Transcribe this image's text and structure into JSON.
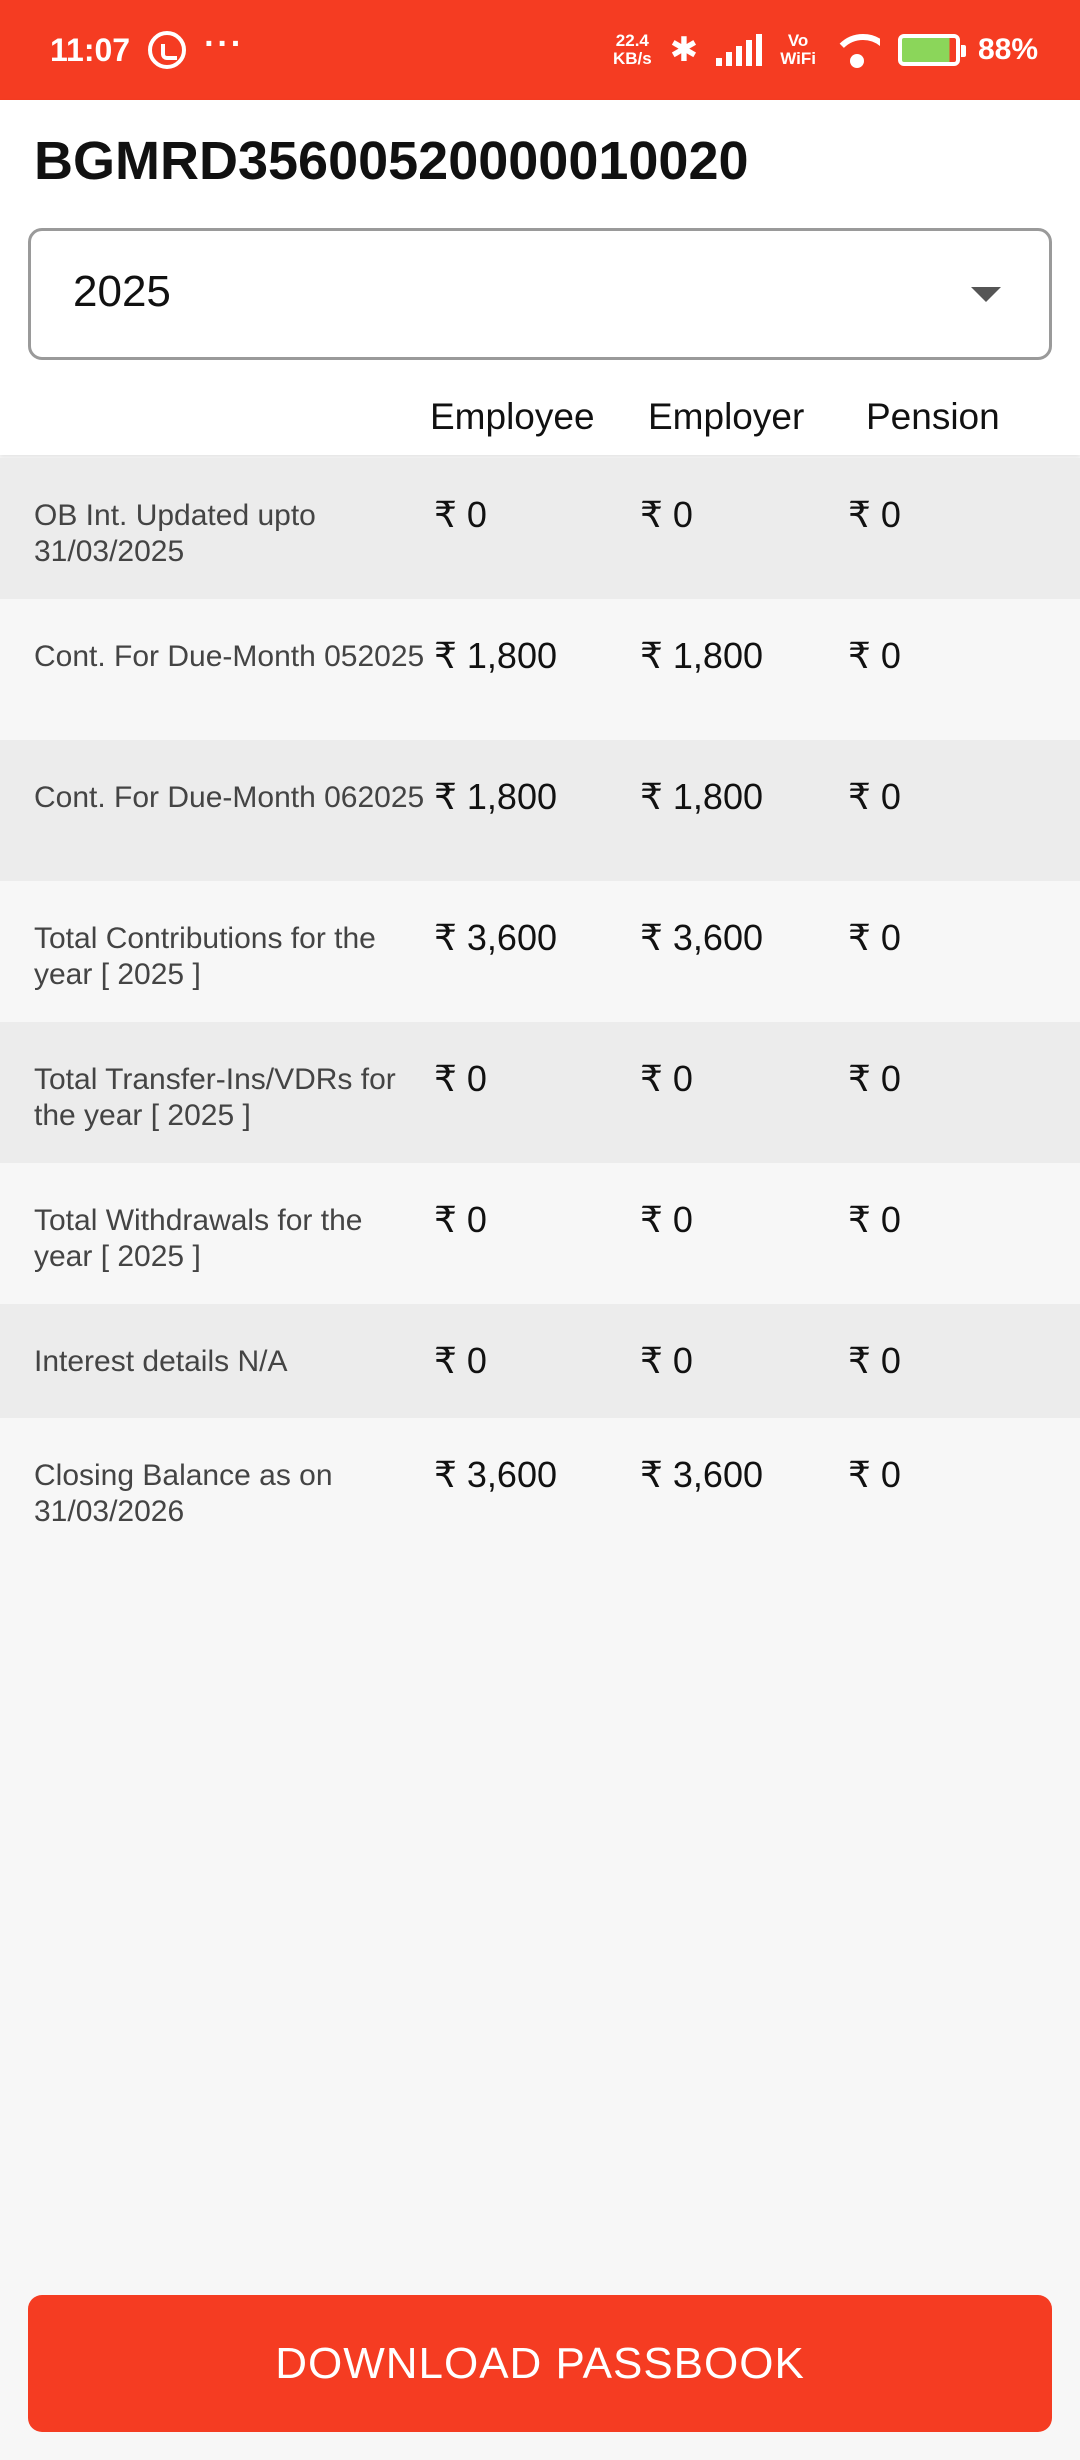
{
  "status_bar": {
    "time": "11:07",
    "speed_value": "22.4",
    "speed_unit": "KB/s",
    "vowifi_top": "Vo",
    "vowifi_bottom": "WiFi",
    "battery": "88%",
    "icons": [
      "whatsapp-icon",
      "more-dots-icon",
      "bluetooth-icon",
      "signal-icon",
      "wifi-icon",
      "battery-icon"
    ]
  },
  "header": {
    "account_id": "BGMRD35600520000010020",
    "year_select": {
      "selected": "2025"
    },
    "columns": [
      "Employee",
      "Employer",
      "Pension"
    ]
  },
  "rows": [
    {
      "label": "OB Int. Updated upto 31/03/2025",
      "employee": "₹ 0",
      "employer": "₹ 0",
      "pension": "₹ 0"
    },
    {
      "label": "Cont. For Due-Month 052025",
      "employee": "₹ 1,800",
      "employer": "₹ 1,800",
      "pension": "₹ 0"
    },
    {
      "label": "Cont. For Due-Month 062025",
      "employee": "₹ 1,800",
      "employer": "₹ 1,800",
      "pension": "₹ 0"
    },
    {
      "label": "Total Contributions for the year [ 2025 ]",
      "employee": "₹ 3,600",
      "employer": "₹ 3,600",
      "pension": "₹ 0"
    },
    {
      "label": "Total Transfer-Ins/VDRs for the year [ 2025 ]",
      "employee": "₹ 0",
      "employer": "₹ 0",
      "pension": "₹ 0"
    },
    {
      "label": "Total Withdrawals for the year [ 2025 ]",
      "employee": "₹ 0",
      "employer": "₹ 0",
      "pension": "₹ 0"
    },
    {
      "label": "Interest details N/A",
      "employee": "₹ 0",
      "employer": "₹ 0",
      "pension": "₹ 0"
    },
    {
      "label": "Closing Balance as on 31/03/2026",
      "employee": "₹ 3,600",
      "employer": "₹ 3,600",
      "pension": "₹ 0"
    }
  ],
  "download_button": {
    "label": "DOWNLOAD PASSBOOK"
  },
  "colors": {
    "accent": "#f53c22",
    "row_alt": "#ececec",
    "background": "#f7f7f7"
  }
}
